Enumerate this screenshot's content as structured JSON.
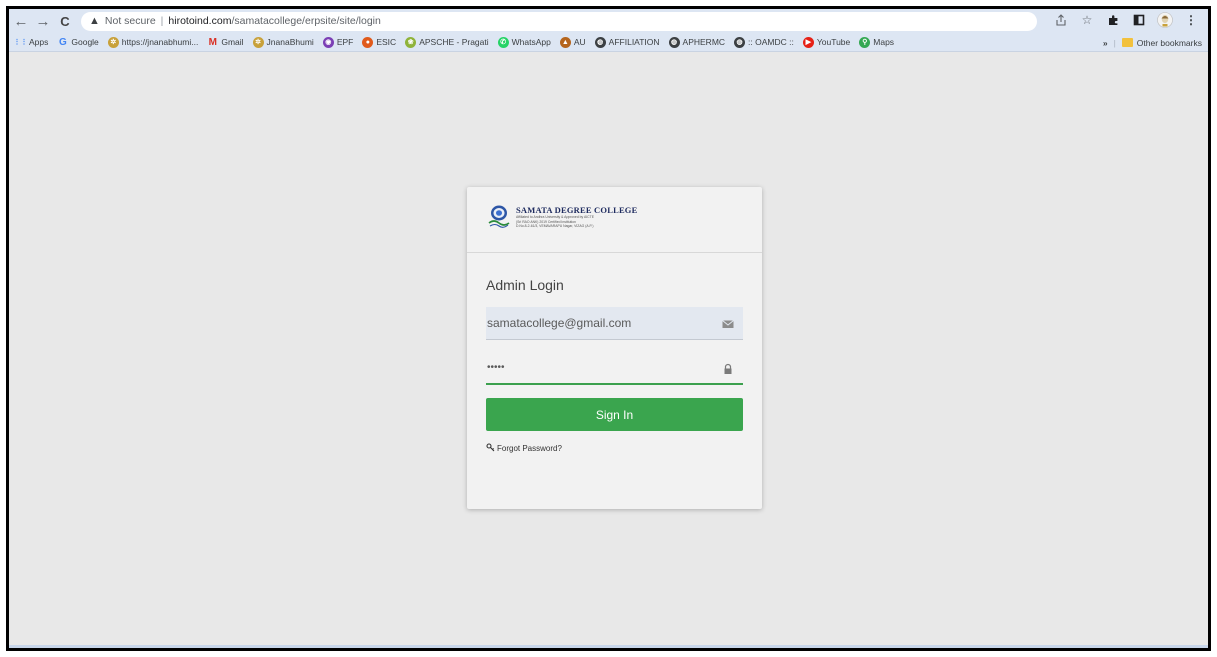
{
  "browser": {
    "nav": {
      "back": "←",
      "forward": "→",
      "reload": "C"
    },
    "address": {
      "security_label": "Not secure",
      "url_host": "hirotoind.com",
      "url_path": "/samatacollege/erpsite/site/login"
    },
    "toolbar_icons": [
      "share-icon",
      "star-icon",
      "extensions-icon",
      "sidepanel-icon",
      "profile-icon",
      "menu-icon"
    ],
    "bookmarks": [
      {
        "label": "Apps",
        "icon": "apps-grid",
        "color": "#4285f4"
      },
      {
        "label": "Google",
        "icon": "google-g",
        "color": "#4285f4"
      },
      {
        "label": "https://jnanabhumi...",
        "icon": "emblem",
        "color": "#c8a13a"
      },
      {
        "label": "Gmail",
        "icon": "gmail-m",
        "color": "#d93025"
      },
      {
        "label": "JnanaBhumi",
        "icon": "emblem",
        "color": "#c8a13a"
      },
      {
        "label": "EPF",
        "icon": "epf-circle",
        "color": "#7b3fb5"
      },
      {
        "label": "ESIC",
        "icon": "esic-circle",
        "color": "#e05a1c"
      },
      {
        "label": "APSCHE - Pragati",
        "icon": "apsche-logo",
        "color": "#8fb33a"
      },
      {
        "label": "WhatsApp",
        "icon": "whatsapp",
        "color": "#25d366"
      },
      {
        "label": "AU",
        "icon": "au-logo",
        "color": "#b5651d"
      },
      {
        "label": "AFFILIATION",
        "icon": "globe",
        "color": "#3c4043"
      },
      {
        "label": "APHERMC",
        "icon": "globe",
        "color": "#3c4043"
      },
      {
        "label": ":: OAMDC ::",
        "icon": "globe",
        "color": "#3c4043"
      },
      {
        "label": "YouTube",
        "icon": "youtube",
        "color": "#e62117"
      },
      {
        "label": "Maps",
        "icon": "maps-pin",
        "color": "#34a853"
      }
    ],
    "bookmarks_more": "»",
    "other_bookmarks": "Other bookmarks"
  },
  "login": {
    "logo_title": "SAMATA DEGREE COLLEGE",
    "logo_lines": [
      "Affiliated to Andhra University & Approved by AICTE",
      "(Sri RAO ANK) 2019 Certified Institution",
      "D.No.8-2-61/3, VEMAVARAPU Nagar, VIZAG (A.P.)"
    ],
    "title": "Admin Login",
    "email_value": "samatacollege@gmail.com",
    "password_value": "•••••",
    "signin_label": "Sign In",
    "forgot_label": "Forgot Password?"
  },
  "colors": {
    "signin": "#3aa54e",
    "field_focus": "#3ca04e",
    "toolbar": "#dde6f3",
    "page_bg": "#e8e8e8"
  }
}
